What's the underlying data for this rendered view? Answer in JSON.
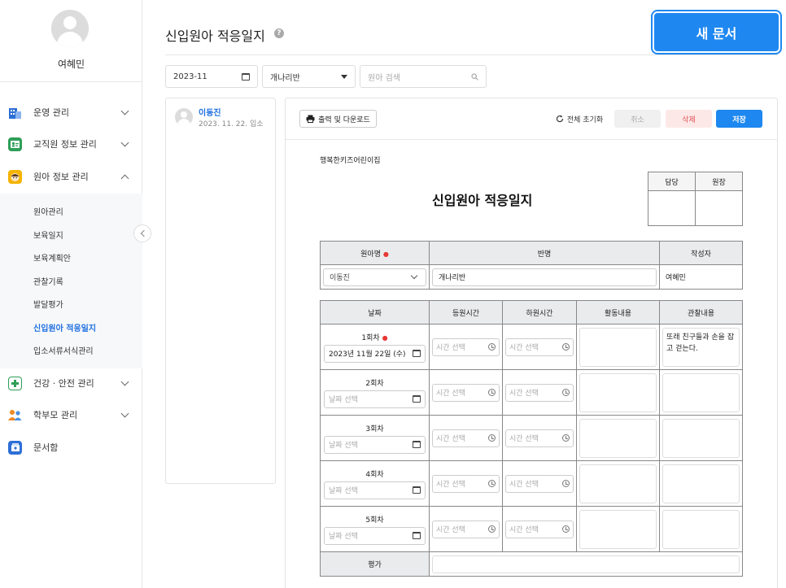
{
  "user": {
    "name": "여혜민"
  },
  "sidebar": {
    "menus": [
      {
        "label": "운영 관리",
        "icon": "building-icon",
        "color": "#2d6fd6"
      },
      {
        "label": "교직원 정보 관리",
        "icon": "staff-card-icon",
        "color": "#2e9e57"
      },
      {
        "label": "원아 정보 관리",
        "icon": "child-face-icon",
        "color": "#f5b400"
      },
      {
        "label": "건강 · 안전 관리",
        "icon": "first-aid-icon",
        "color": "#2e9e57"
      },
      {
        "label": "학부모 관리",
        "icon": "parents-icon",
        "color": "#f08a24"
      },
      {
        "label": "문서함",
        "icon": "document-box-icon",
        "color": "#2d6fd6"
      }
    ],
    "submenu": [
      "원아관리",
      "보육일지",
      "보육계획안",
      "관찰기록",
      "발달평가",
      "신입원아 적응일지",
      "입소서류서식관리"
    ]
  },
  "header": {
    "title": "신입원아 적응일지",
    "help_icon": "?",
    "new_button": "새 문서"
  },
  "filters": {
    "month": "2023-11",
    "class": "개나리반",
    "search_placeholder": "원아 검색"
  },
  "child_list": [
    {
      "name": "이동진",
      "date": "2023. 11. 22. 입소"
    }
  ],
  "toolbar": {
    "print": "출력 및 다운로드",
    "reset": "전체 초기화",
    "cancel": "취소",
    "delete": "삭제",
    "save": "저장"
  },
  "document": {
    "center": "행복한키즈어린이집",
    "title": "신입원아 적응일지",
    "approval": {
      "h1": "담당",
      "h2": "원장"
    },
    "info_headers": {
      "child": "원아명",
      "class": "반명",
      "writer": "작성자"
    },
    "info_values": {
      "child": "이동진",
      "class": "개나리반",
      "writer": "여혜민"
    },
    "headers": {
      "date": "날짜",
      "arrive": "등원시간",
      "leave": "하원시간",
      "activity": "활동내용",
      "observe": "관찰내용"
    },
    "time_placeholder": "시간 선택",
    "date_placeholder": "날짜 선택",
    "rows": [
      {
        "round": "1회차",
        "date": "2023년 11월 22일 (수)",
        "observe": "또래 친구들과 손을 잡고 걷는다."
      },
      {
        "round": "2회차",
        "date": "",
        "observe": ""
      },
      {
        "round": "3회차",
        "date": "",
        "observe": ""
      },
      {
        "round": "4회차",
        "date": "",
        "observe": ""
      },
      {
        "round": "5회차",
        "date": "",
        "observe": ""
      }
    ],
    "eval_label": "평가"
  },
  "colors": {
    "accent": "#1e88f0",
    "active_menu": "#1f6fe0",
    "delete": "#e05050"
  }
}
